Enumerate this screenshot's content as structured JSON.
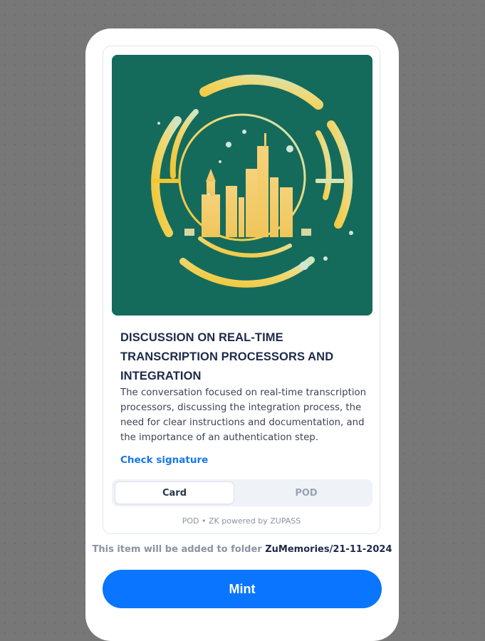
{
  "card": {
    "image_description_icon": "city-skyline-emblem-image",
    "title": "DISCUSSION ON REAL-TIME TRANSCRIPTION PROCESSORS AND INTEGRATION",
    "description": "The conversation focused on real-time transcription processors, discussing the integration process, the need for clear instructions and documentation, and the importance of an authentication step.",
    "check_signature_label": "Check signature",
    "tabs": [
      {
        "label": "Card",
        "active": true
      },
      {
        "label": "POD",
        "active": false
      }
    ],
    "footer": "POD • ZK powered by ZUPASS"
  },
  "folder_notice": {
    "prefix": "This item will be added to folder",
    "path": "ZuMemories/21-11-2024"
  },
  "mint_label": "Mint",
  "colors": {
    "accent": "#0a75ff",
    "link": "#1677e8",
    "art_background": "#156b5b",
    "title": "#1e2a4a"
  }
}
